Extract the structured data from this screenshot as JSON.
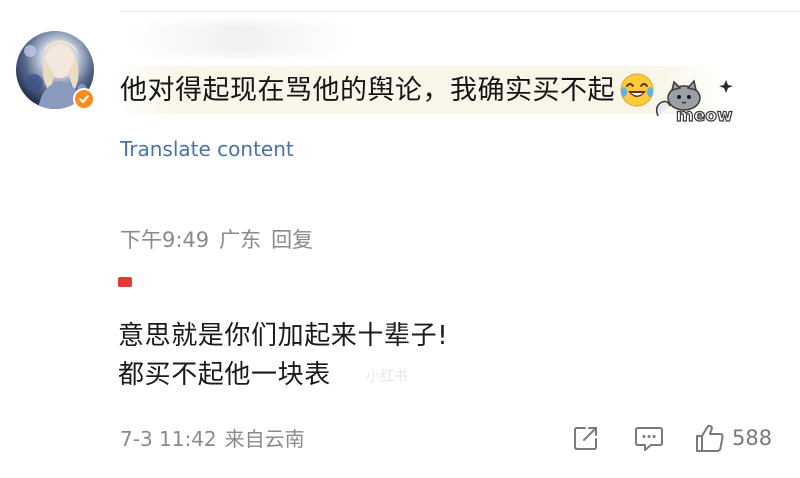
{
  "comment": {
    "text": "他对得起现在骂他的舆论，我确实买不起",
    "emoji": "laughing-face",
    "sticker_text": "meow",
    "translate_label": "Translate content"
  },
  "reply_meta": {
    "time": "下午9:49",
    "location": "广东",
    "reply_label": "回复"
  },
  "quote": {
    "line1": "意思就是你们加起来十辈子!",
    "line2": "都买不起他一块表",
    "watermark": "小红书"
  },
  "post_meta": {
    "date": "7-3 11:42",
    "source": "来自云南"
  },
  "actions": {
    "share_icon": "share-icon",
    "comment_icon": "comment-icon",
    "like_icon": "thumbs-up-icon",
    "like_count": "588"
  },
  "colors": {
    "link": "#4a72a8",
    "meta": "#8a8a8a",
    "badge": "#ff8a1f",
    "highlight": "#f9f6e9"
  }
}
